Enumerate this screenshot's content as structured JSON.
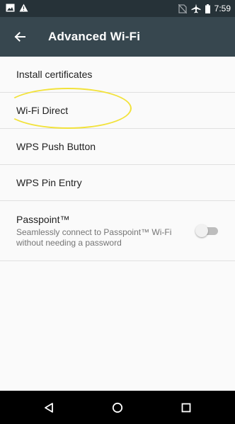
{
  "status_bar": {
    "time": "7:59",
    "icons": [
      "image-icon",
      "alert-icon",
      "no-sim-icon",
      "airplane-icon",
      "battery-icon"
    ]
  },
  "app_bar": {
    "title": "Advanced Wi-Fi",
    "back_icon": "arrow-left-icon"
  },
  "settings": {
    "items": [
      {
        "label": "Install certificates"
      },
      {
        "label": "Wi-Fi Direct"
      },
      {
        "label": "WPS Push Button"
      },
      {
        "label": "WPS Pin Entry"
      }
    ],
    "passpoint": {
      "title": "Passpoint™",
      "subtitle": "Seamlessly connect to Passpoint™ Wi-Fi without needing a password",
      "enabled": false
    }
  },
  "nav_bar": {
    "icons": [
      "back-triangle-icon",
      "home-circle-icon",
      "recents-square-icon"
    ]
  },
  "colors": {
    "status_bar": "#263238",
    "app_bar": "#37474f",
    "annotation": "#f2e23a"
  }
}
